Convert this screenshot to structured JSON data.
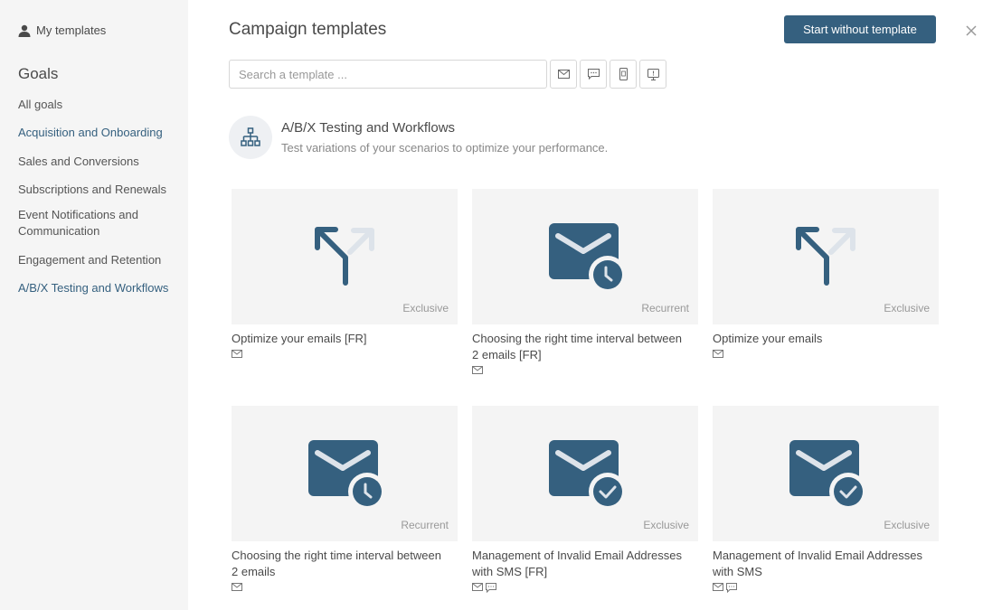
{
  "sidebar": {
    "my_templates_label": "My templates",
    "title": "Goals",
    "items": [
      {
        "label": "All goals",
        "active": false
      },
      {
        "label": "Acquisition and Onboarding",
        "active": true
      },
      {
        "label": "Sales and Conversions",
        "active": false
      },
      {
        "label": "Subscriptions and Renewals",
        "active": false
      },
      {
        "label": "Event Notifications and Communication",
        "active": false
      },
      {
        "label": "Engagement and Retention",
        "active": false
      },
      {
        "label": "A/B/X Testing and Workflows",
        "active": true
      }
    ]
  },
  "header": {
    "title": "Campaign templates",
    "start_button": "Start without template"
  },
  "search": {
    "placeholder": "Search a template ..."
  },
  "filters": [
    {
      "name": "email-icon"
    },
    {
      "name": "sms-icon"
    },
    {
      "name": "mobile-icon"
    },
    {
      "name": "web-push-icon"
    }
  ],
  "section": {
    "title": "A/B/X Testing and Workflows",
    "description": "Test variations of your scenarios to optimize your performance."
  },
  "colors": {
    "accent": "#35607f",
    "icon_light": "#dde3ea",
    "sidebar_bg": "#f5f5f5",
    "thumb_bg": "#f4f4f4"
  },
  "cards": [
    {
      "title": "Optimize your emails [FR]",
      "badge": "Exclusive",
      "icon": "split-arrow-icon",
      "channels": [
        "email-icon"
      ]
    },
    {
      "title": "Choosing the right time interval between 2 emails [FR]",
      "badge": "Recurrent",
      "icon": "email-clock-icon",
      "channels": [
        "email-icon"
      ]
    },
    {
      "title": "Optimize your emails",
      "badge": "Exclusive",
      "icon": "split-arrow-icon",
      "channels": [
        "email-icon"
      ]
    },
    {
      "title": "Choosing the right time interval between 2 emails",
      "badge": "Recurrent",
      "icon": "email-clock-icon",
      "channels": [
        "email-icon"
      ]
    },
    {
      "title": "Management of Invalid Email Addresses with SMS [FR]",
      "badge": "Exclusive",
      "icon": "email-check-icon",
      "channels": [
        "email-icon",
        "sms-icon"
      ]
    },
    {
      "title": "Management of Invalid Email Addresses with SMS",
      "badge": "Exclusive",
      "icon": "email-check-icon",
      "channels": [
        "email-icon",
        "sms-icon"
      ]
    }
  ]
}
